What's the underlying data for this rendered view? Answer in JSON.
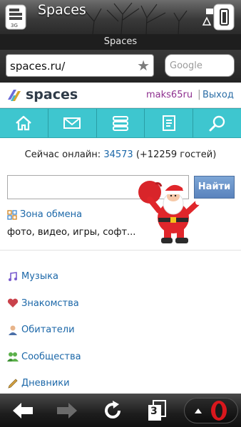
{
  "status_bar": {
    "app_title": "Spaces"
  },
  "browser": {
    "tab_title": "Spaces",
    "address": "spaces.ru/",
    "search_placeholder": "Google",
    "tabs_count": "3"
  },
  "site": {
    "logo_text": "spaces",
    "username": "maks65ru",
    "separator": "|",
    "exit_label": "Выход",
    "nav": [
      "home-icon",
      "mail-icon",
      "feed-icon",
      "notes-icon",
      "search-icon"
    ],
    "online": {
      "label": "Сейчас онлайн:",
      "count": "34573",
      "guests": "(+12259 гостей)"
    },
    "search_button": "Найти",
    "exchange": {
      "title": "Зона обмена",
      "subtitle": "фото, видео, игры, софт..."
    },
    "menu": [
      {
        "label": "Музыка",
        "icon": "music-note-icon"
      },
      {
        "label": "Знакомства",
        "icon": "heart-icon"
      },
      {
        "label": "Обитатели",
        "icon": "person-icon"
      },
      {
        "label": "Сообщества",
        "icon": "group-icon"
      },
      {
        "label": "Дневники",
        "icon": "pen-icon"
      }
    ]
  },
  "colors": {
    "nav_bg": "#3ec6cf",
    "link": "#1b67a8",
    "username": "#8e2f8f",
    "button": "#6a93c9"
  }
}
